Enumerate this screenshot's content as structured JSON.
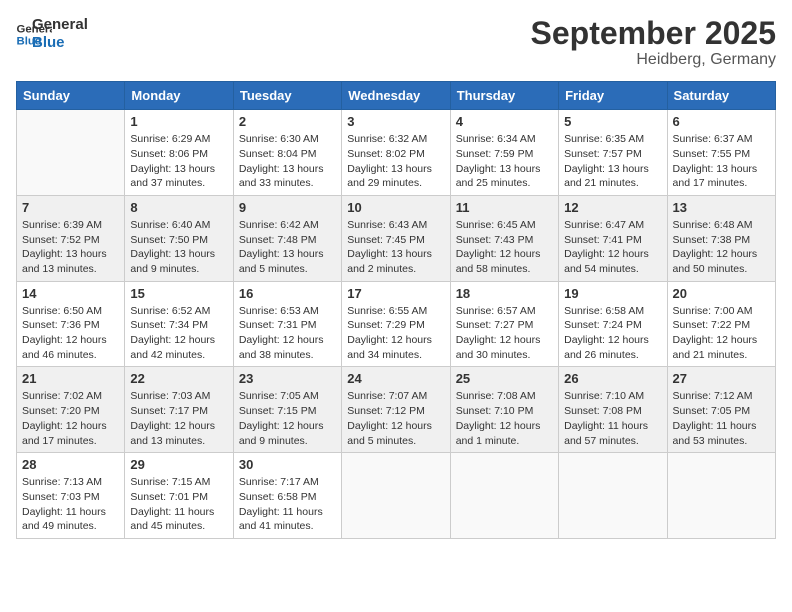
{
  "header": {
    "logo_line1": "General",
    "logo_line2": "Blue",
    "month": "September 2025",
    "location": "Heidberg, Germany"
  },
  "weekdays": [
    "Sunday",
    "Monday",
    "Tuesday",
    "Wednesday",
    "Thursday",
    "Friday",
    "Saturday"
  ],
  "weeks": [
    [
      {
        "day": "",
        "info": ""
      },
      {
        "day": "1",
        "info": "Sunrise: 6:29 AM\nSunset: 8:06 PM\nDaylight: 13 hours\nand 37 minutes."
      },
      {
        "day": "2",
        "info": "Sunrise: 6:30 AM\nSunset: 8:04 PM\nDaylight: 13 hours\nand 33 minutes."
      },
      {
        "day": "3",
        "info": "Sunrise: 6:32 AM\nSunset: 8:02 PM\nDaylight: 13 hours\nand 29 minutes."
      },
      {
        "day": "4",
        "info": "Sunrise: 6:34 AM\nSunset: 7:59 PM\nDaylight: 13 hours\nand 25 minutes."
      },
      {
        "day": "5",
        "info": "Sunrise: 6:35 AM\nSunset: 7:57 PM\nDaylight: 13 hours\nand 21 minutes."
      },
      {
        "day": "6",
        "info": "Sunrise: 6:37 AM\nSunset: 7:55 PM\nDaylight: 13 hours\nand 17 minutes."
      }
    ],
    [
      {
        "day": "7",
        "info": "Sunrise: 6:39 AM\nSunset: 7:52 PM\nDaylight: 13 hours\nand 13 minutes."
      },
      {
        "day": "8",
        "info": "Sunrise: 6:40 AM\nSunset: 7:50 PM\nDaylight: 13 hours\nand 9 minutes."
      },
      {
        "day": "9",
        "info": "Sunrise: 6:42 AM\nSunset: 7:48 PM\nDaylight: 13 hours\nand 5 minutes."
      },
      {
        "day": "10",
        "info": "Sunrise: 6:43 AM\nSunset: 7:45 PM\nDaylight: 13 hours\nand 2 minutes."
      },
      {
        "day": "11",
        "info": "Sunrise: 6:45 AM\nSunset: 7:43 PM\nDaylight: 12 hours\nand 58 minutes."
      },
      {
        "day": "12",
        "info": "Sunrise: 6:47 AM\nSunset: 7:41 PM\nDaylight: 12 hours\nand 54 minutes."
      },
      {
        "day": "13",
        "info": "Sunrise: 6:48 AM\nSunset: 7:38 PM\nDaylight: 12 hours\nand 50 minutes."
      }
    ],
    [
      {
        "day": "14",
        "info": "Sunrise: 6:50 AM\nSunset: 7:36 PM\nDaylight: 12 hours\nand 46 minutes."
      },
      {
        "day": "15",
        "info": "Sunrise: 6:52 AM\nSunset: 7:34 PM\nDaylight: 12 hours\nand 42 minutes."
      },
      {
        "day": "16",
        "info": "Sunrise: 6:53 AM\nSunset: 7:31 PM\nDaylight: 12 hours\nand 38 minutes."
      },
      {
        "day": "17",
        "info": "Sunrise: 6:55 AM\nSunset: 7:29 PM\nDaylight: 12 hours\nand 34 minutes."
      },
      {
        "day": "18",
        "info": "Sunrise: 6:57 AM\nSunset: 7:27 PM\nDaylight: 12 hours\nand 30 minutes."
      },
      {
        "day": "19",
        "info": "Sunrise: 6:58 AM\nSunset: 7:24 PM\nDaylight: 12 hours\nand 26 minutes."
      },
      {
        "day": "20",
        "info": "Sunrise: 7:00 AM\nSunset: 7:22 PM\nDaylight: 12 hours\nand 21 minutes."
      }
    ],
    [
      {
        "day": "21",
        "info": "Sunrise: 7:02 AM\nSunset: 7:20 PM\nDaylight: 12 hours\nand 17 minutes."
      },
      {
        "day": "22",
        "info": "Sunrise: 7:03 AM\nSunset: 7:17 PM\nDaylight: 12 hours\nand 13 minutes."
      },
      {
        "day": "23",
        "info": "Sunrise: 7:05 AM\nSunset: 7:15 PM\nDaylight: 12 hours\nand 9 minutes."
      },
      {
        "day": "24",
        "info": "Sunrise: 7:07 AM\nSunset: 7:12 PM\nDaylight: 12 hours\nand 5 minutes."
      },
      {
        "day": "25",
        "info": "Sunrise: 7:08 AM\nSunset: 7:10 PM\nDaylight: 12 hours\nand 1 minute."
      },
      {
        "day": "26",
        "info": "Sunrise: 7:10 AM\nSunset: 7:08 PM\nDaylight: 11 hours\nand 57 minutes."
      },
      {
        "day": "27",
        "info": "Sunrise: 7:12 AM\nSunset: 7:05 PM\nDaylight: 11 hours\nand 53 minutes."
      }
    ],
    [
      {
        "day": "28",
        "info": "Sunrise: 7:13 AM\nSunset: 7:03 PM\nDaylight: 11 hours\nand 49 minutes."
      },
      {
        "day": "29",
        "info": "Sunrise: 7:15 AM\nSunset: 7:01 PM\nDaylight: 11 hours\nand 45 minutes."
      },
      {
        "day": "30",
        "info": "Sunrise: 7:17 AM\nSunset: 6:58 PM\nDaylight: 11 hours\nand 41 minutes."
      },
      {
        "day": "",
        "info": ""
      },
      {
        "day": "",
        "info": ""
      },
      {
        "day": "",
        "info": ""
      },
      {
        "day": "",
        "info": ""
      }
    ]
  ]
}
